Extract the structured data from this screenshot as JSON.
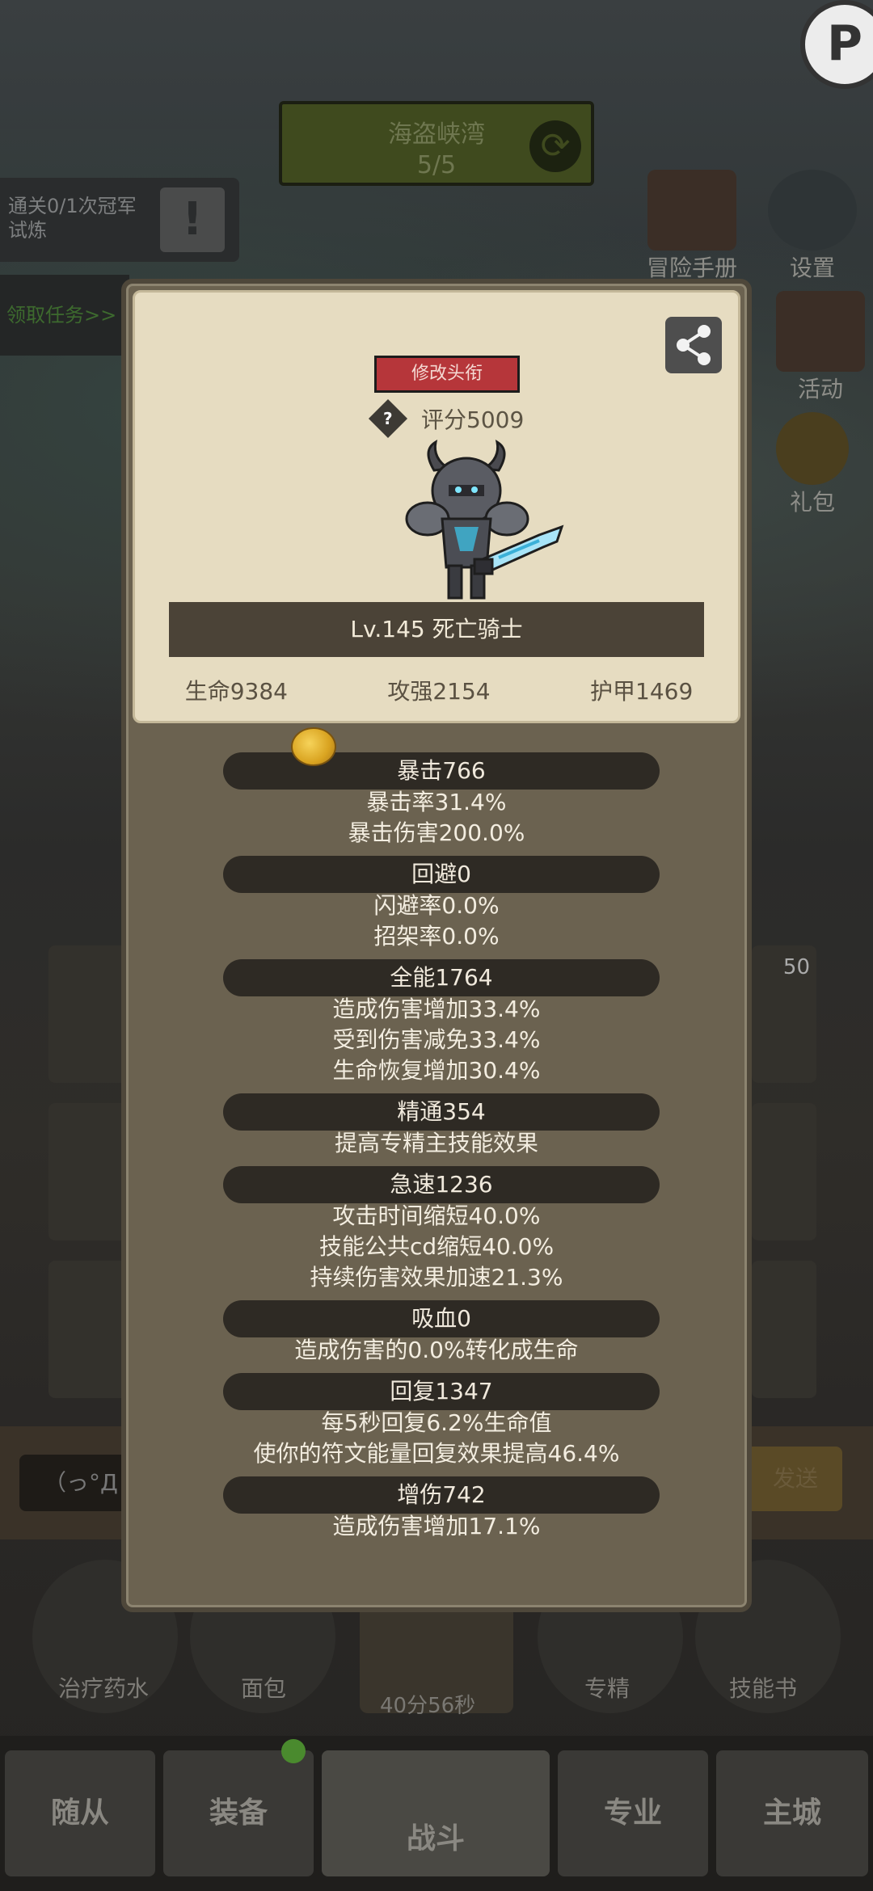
{
  "background": {
    "stage_name": "海盗峡湾",
    "stage_progress": "5/5",
    "trial_text": "通关0/1次冠军试炼",
    "task_link": "领取任务>>",
    "side_icons": {
      "manual": "冒险手册",
      "settings": "设置",
      "activity": "活动",
      "gift": "礼包"
    },
    "consumables": {
      "potion": "治疗药水",
      "bread": "面包",
      "specialty": "专精",
      "skillbook": "技能书"
    },
    "timer": "40分56秒",
    "chat_emote": "（っ°Д",
    "chat_send": "发送",
    "card_badge": "50",
    "nav": {
      "followers": "随从",
      "equipment": "装备",
      "battle": "战斗",
      "profession": "专业",
      "main_city": "主城"
    }
  },
  "panel": {
    "rename_button": "修改头衔",
    "help_icon": "?",
    "score": "评分5009",
    "hero_name": "Lv.145 死亡骑士",
    "stats": {
      "hp": "生命9384",
      "attack": "攻强2154",
      "armor": "护甲1469"
    },
    "attributes": [
      {
        "head": "暴击766",
        "lines": [
          "暴击率31.4%",
          "暴击伤害200.0%"
        ]
      },
      {
        "head": "回避0",
        "lines": [
          "闪避率0.0%",
          "招架率0.0%"
        ]
      },
      {
        "head": "全能1764",
        "lines": [
          "造成伤害增加33.4%",
          "受到伤害减免33.4%",
          "生命恢复增加30.4%"
        ]
      },
      {
        "head": "精通354",
        "lines": [
          "提高专精主技能效果"
        ]
      },
      {
        "head": "急速1236",
        "lines": [
          "攻击时间缩短40.0%",
          "技能公共cd缩短40.0%",
          "持续伤害效果加速21.3%"
        ]
      },
      {
        "head": "吸血0",
        "lines": [
          "造成伤害的0.0%转化成生命"
        ]
      },
      {
        "head": "回复1347",
        "lines": [
          "每5秒回复6.2%生命值",
          "使你的符文能量回复效果提高46.4%"
        ]
      },
      {
        "head": "增伤742",
        "lines": [
          "造成伤害增加17.1%"
        ]
      }
    ]
  }
}
